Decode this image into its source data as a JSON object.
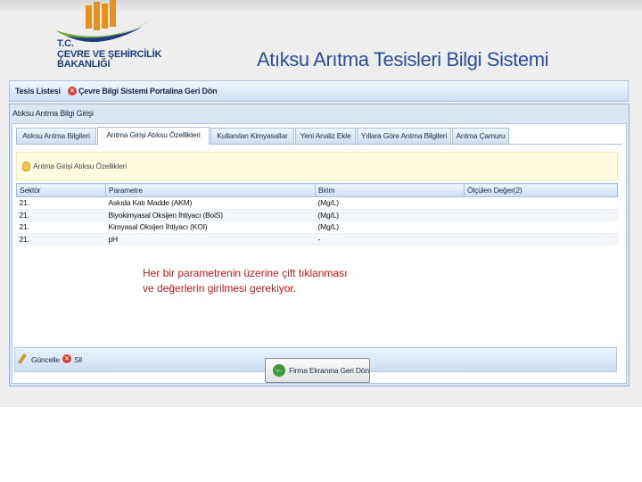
{
  "branding": {
    "org_line1": "T.C.",
    "org_line2": "ÇEVRE VE ŞEHİRCİLİK",
    "org_line3": "BAKANLIĞI",
    "app_title": "Atıksu Arıtma Tesisleri Bilgi Sistemi",
    "logo_icon": "ministry-logo-icon",
    "colors": {
      "brand_blue": "#1f3e7c",
      "brand_orange": "#e8901e",
      "brand_green": "#6fae3a"
    }
  },
  "toolbar": {
    "facility_list": "Tesis Listesi",
    "portal_return": "Çevre Bilgi Sistemi Portalina Geri Dön"
  },
  "panel": {
    "title": "Atıksu Arıtma Bilgi Girişi",
    "tabs": [
      {
        "label": "Atıksu Arıtma Bilgileri",
        "active": false
      },
      {
        "label": "Arıtma Girişi Atıksu Özellikleri",
        "active": true
      },
      {
        "label": "Kullanılan Kimyasallar",
        "active": false
      },
      {
        "label": "Yeni Analiz Ekle",
        "active": false
      },
      {
        "label": "Yıllara Göre Arıtma Bilgileri",
        "active": false
      },
      {
        "label": "Arıtma Çamuru",
        "active": false
      }
    ],
    "section_label": "Arıtma Girişi Atıksu Özellikleri",
    "columns": [
      "Sektör",
      "Parametre",
      "Birim",
      "Ölçülen Değer(2)"
    ],
    "rows": [
      {
        "sektor": "21.",
        "parametre": "Askıda Katı Madde (AKM)",
        "birim": "(Mg/L)",
        "deger": ""
      },
      {
        "sektor": "21.",
        "parametre": "Biyokimyasal Oksijen İhtiyacı (BoiS)",
        "birim": "(Mg/L)",
        "deger": ""
      },
      {
        "sektor": "21.",
        "parametre": "Kimyasal Oksijen İhtiyacı (KOI)",
        "birim": "(Mg/L)",
        "deger": ""
      },
      {
        "sektor": "21.",
        "parametre": "pH",
        "birim": "-",
        "deger": ""
      }
    ],
    "update_label": "Güncelle",
    "delete_label": "Sil"
  },
  "note": {
    "line1": "Her bir parametrenin üzerine çift tıklanması",
    "line2": "ve değerlerin girilmesi gerekiyor."
  },
  "return_button": "Firma Ekranına Geri Dön"
}
